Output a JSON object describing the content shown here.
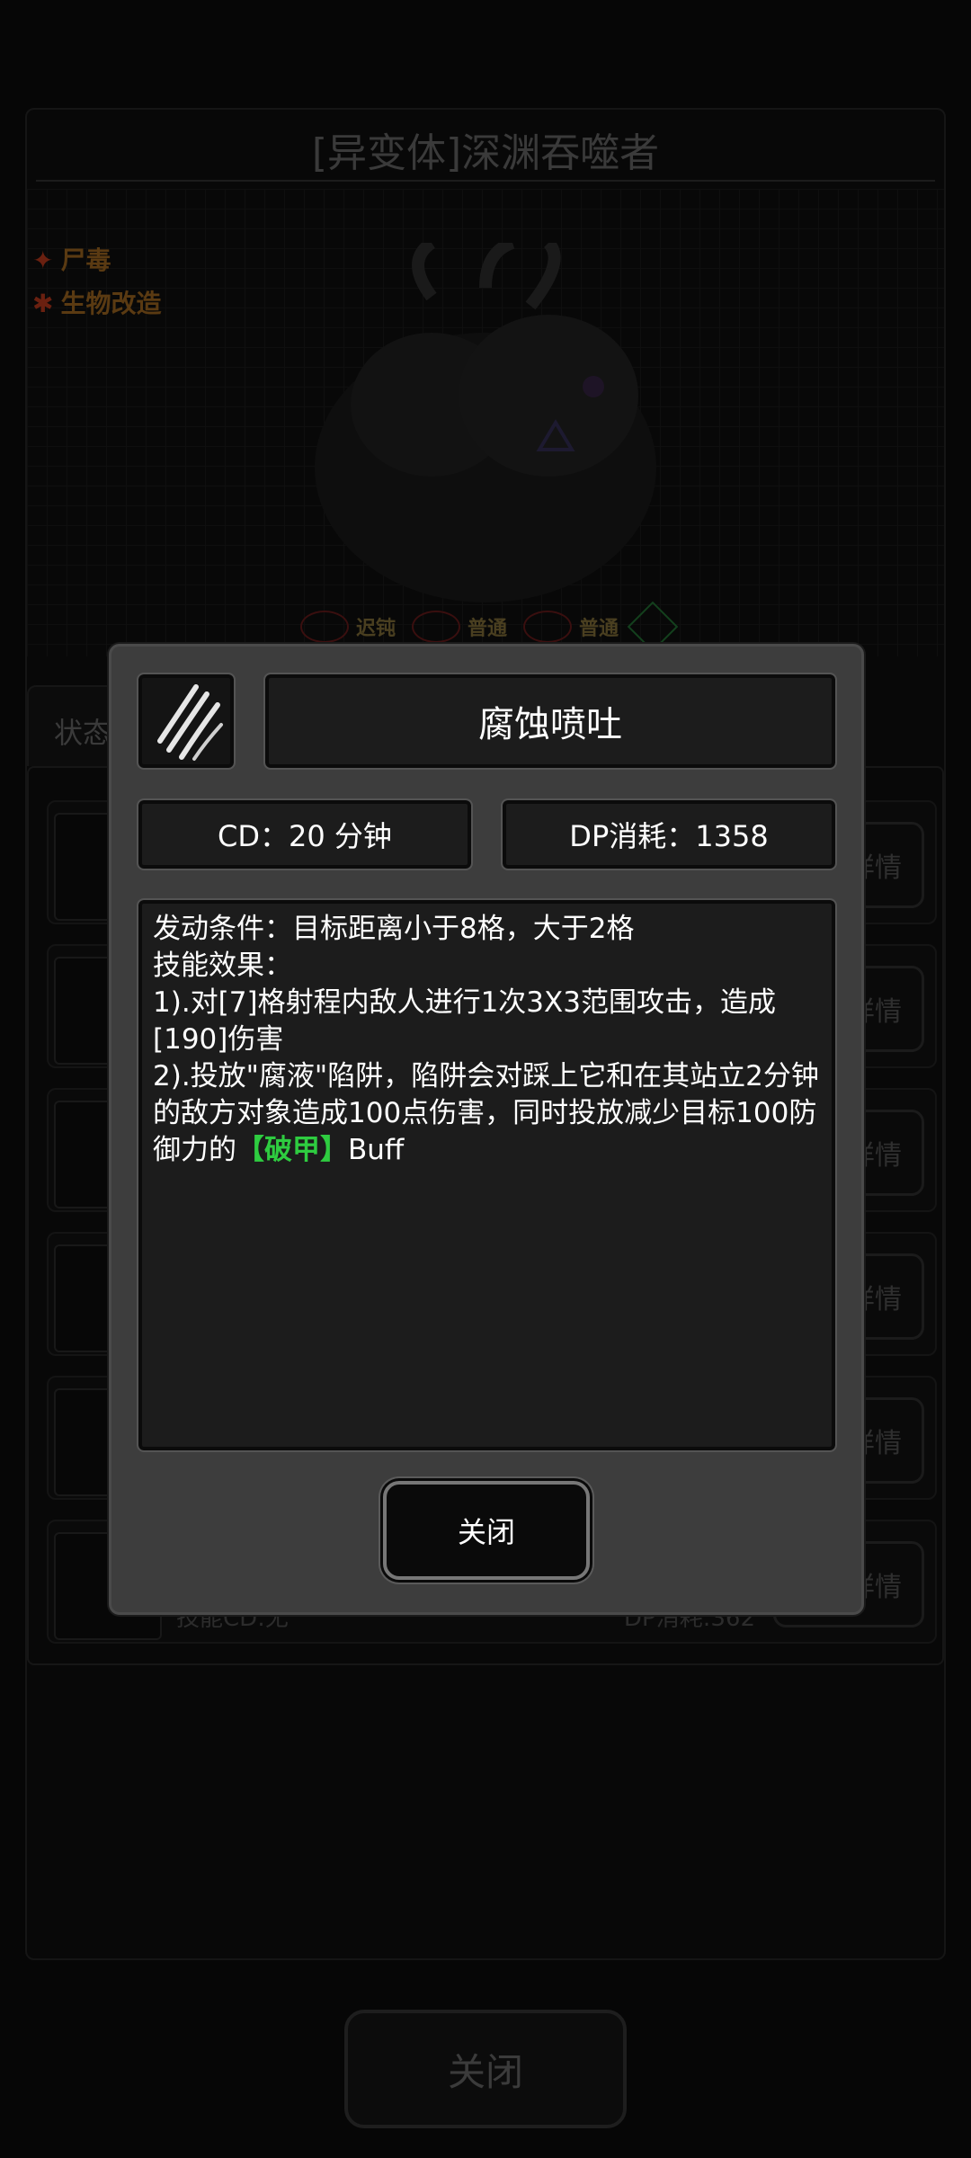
{
  "background": {
    "title": "[异变体]深渊吞噬者",
    "status_effects": [
      {
        "icon": "claw-icon",
        "label": "尸毒"
      },
      {
        "icon": "star-icon",
        "label": "生物改造"
      }
    ],
    "traits": [
      {
        "icon": "eye-icon",
        "label": "迟钝"
      },
      {
        "icon": "ear-icon",
        "label": "普通"
      },
      {
        "icon": "nose-icon",
        "label": "普通"
      },
      {
        "icon": "question-icon",
        "label": ""
      }
    ],
    "tab_label": "状态",
    "list_rows": [
      {
        "button": "详情"
      },
      {
        "button": "详情"
      },
      {
        "button": "详情"
      },
      {
        "button": "详情"
      },
      {
        "button": "详情"
      },
      {
        "button": "详情",
        "cd": "技能CD:无",
        "dp": "DP消耗:362"
      }
    ],
    "close_label": "关闭"
  },
  "dialog": {
    "skill_icon": "claw-scratch-icon",
    "skill_name": "腐蚀喷吐",
    "cd_text": "CD：20 分钟",
    "dp_text": "DP消耗：1358",
    "description": {
      "line1": "发动条件：目标距离小于8格，大于2格",
      "line2": "技能效果：",
      "line3": "1).对[7]格射程内敌人进行1次3X3范围攻击，造成[190]伤害",
      "line4_prefix": "2).投放\"腐液\"陷阱，陷阱会对踩上它和在其站立2分钟的敌方对象造成100点伤害，同时投放减少目标100防御力的",
      "line4_highlight": "【破甲】",
      "line4_suffix": "Buff"
    },
    "close_label": "关闭",
    "colors": {
      "highlight": "#2ecc40",
      "panel": "#3d3d3d",
      "box": "#1c1c1c"
    }
  }
}
